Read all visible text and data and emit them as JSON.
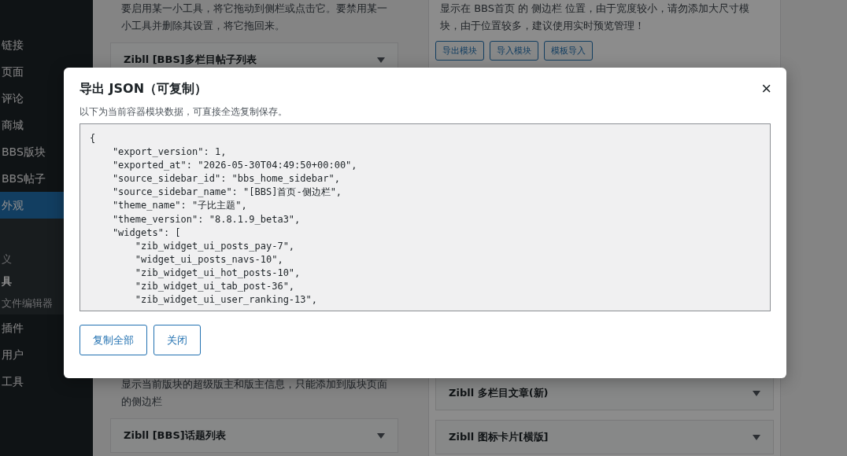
{
  "sidebar": {
    "items": [
      {
        "label": "链接",
        "kind": "menu",
        "selected": false
      },
      {
        "label": "页面",
        "kind": "menu",
        "selected": false
      },
      {
        "label": "评论",
        "kind": "menu",
        "selected": false
      },
      {
        "label": "商城",
        "kind": "menu",
        "selected": false
      },
      {
        "label": "BBS版块",
        "kind": "menu",
        "selected": false
      },
      {
        "label": "BBS帖子",
        "kind": "menu",
        "selected": false
      },
      {
        "label": "外观",
        "kind": "menu",
        "selected": true
      },
      {
        "label": "义",
        "kind": "submenu",
        "selected": false
      },
      {
        "label": "具",
        "kind": "submenu",
        "selected": true
      },
      {
        "label": "文件编辑器",
        "kind": "submenu",
        "selected": false
      },
      {
        "label": "插件",
        "kind": "menu",
        "selected": false
      },
      {
        "label": "用户",
        "kind": "menu",
        "selected": false
      },
      {
        "label": "工具",
        "kind": "menu",
        "selected": false
      }
    ]
  },
  "left_column": {
    "top": [
      {
        "kind": "description",
        "text": "要启用某一小工具，将它拖动到侧栏或点击它。要禁用某一小工具并删除其设置，将它拖回来。"
      },
      {
        "kind": "card",
        "title": "Zibll [BBS]多栏目帖子列表"
      }
    ],
    "bottom": [
      {
        "kind": "description",
        "text": "显示当前版块的超级版主和版主信息，只能添加到版块页面的侧边栏"
      },
      {
        "kind": "card",
        "title": "Zibll [BBS]话题列表"
      }
    ]
  },
  "right_panel": {
    "description": "显示在 BBS首页 的 侧边栏 位置，由于宽度较小，请勿添加大尺寸模块，由于位置较多，建议使用实时预览管理！",
    "buttons": [
      "导出模块",
      "导入模块",
      "模板导入"
    ],
    "cards": [
      "Zibll 多栏目文章(新)",
      "Zibll 图标卡片[横版]"
    ]
  },
  "modal": {
    "title": "导出 JSON（可复制）",
    "close": "×",
    "description": "以下为当前容器模块数据，可直接全选复制保存。",
    "code_lines": [
      "{",
      "    \"export_version\": 1,",
      "    \"exported_at\": \"2026-05-30T04:49:50+00:00\",",
      "    \"source_sidebar_id\": \"bbs_home_sidebar\",",
      "    \"source_sidebar_name\": \"[BBS]首页-侧边栏\",",
      "    \"theme_name\": \"子比主题\",",
      "    \"theme_version\": \"8.8.1.9_beta3\",",
      "    \"widgets\": [",
      "        \"zib_widget_ui_posts_pay-7\",",
      "        \"widget_ui_posts_navs-10\",",
      "        \"zib_widget_ui_hot_posts-10\",",
      "        \"zib_widget_ui_tab_post-36\",",
      "        \"zib_widget_ui_user_ranking-13\","
    ],
    "buttons": [
      "复制全部",
      "关闭"
    ]
  }
}
